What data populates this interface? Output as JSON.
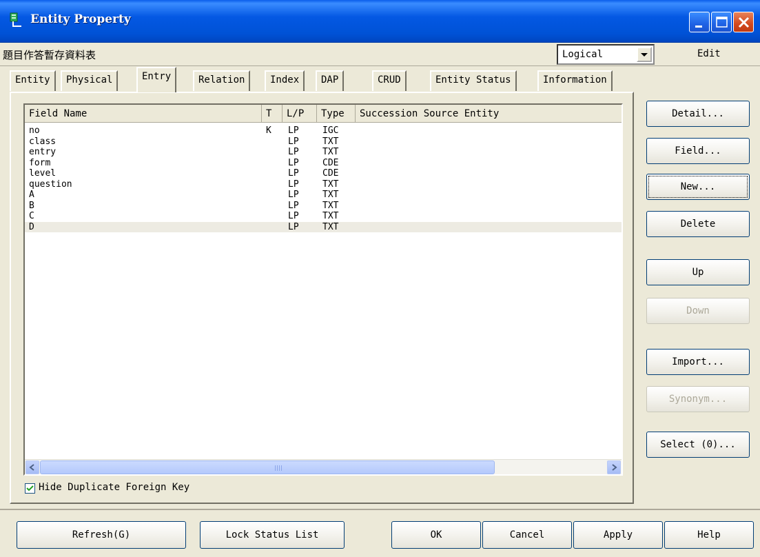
{
  "window": {
    "title": "Entity Property",
    "controls": {
      "minimize": "minimize",
      "maximize": "maximize",
      "close": "close"
    }
  },
  "entity_name": "題目作答暫存資料表",
  "view_select": {
    "value": "Logical"
  },
  "edit_label": "Edit",
  "tabs": [
    {
      "label": "Entity"
    },
    {
      "label": "Physical"
    },
    {
      "label": "Entry",
      "active": true
    },
    {
      "label": "Relation"
    },
    {
      "label": "Index"
    },
    {
      "label": "DAP"
    },
    {
      "label": "CRUD"
    },
    {
      "label": "Entity Status"
    },
    {
      "label": "Information"
    }
  ],
  "list": {
    "columns": [
      "Field  Name",
      "T",
      "L/P",
      "Type",
      "Succession Source Entity"
    ],
    "rows": [
      {
        "name": "no",
        "t": "K",
        "lp": "LP",
        "type": "IGC",
        "source": ""
      },
      {
        "name": "class",
        "t": "",
        "lp": "LP",
        "type": "TXT",
        "source": ""
      },
      {
        "name": "entry",
        "t": "",
        "lp": "LP",
        "type": "TXT",
        "source": ""
      },
      {
        "name": "form",
        "t": "",
        "lp": "LP",
        "type": "CDE",
        "source": ""
      },
      {
        "name": "level",
        "t": "",
        "lp": "LP",
        "type": "CDE",
        "source": ""
      },
      {
        "name": "question",
        "t": "",
        "lp": "LP",
        "type": "TXT",
        "source": ""
      },
      {
        "name": "A",
        "t": "",
        "lp": "LP",
        "type": "TXT",
        "source": ""
      },
      {
        "name": "B",
        "t": "",
        "lp": "LP",
        "type": "TXT",
        "source": ""
      },
      {
        "name": "C",
        "t": "",
        "lp": "LP",
        "type": "TXT",
        "source": ""
      },
      {
        "name": "D",
        "t": "",
        "lp": "LP",
        "type": "TXT",
        "source": "",
        "selected": true
      }
    ]
  },
  "hide_duplicate_fk": {
    "label": "Hide Duplicate Foreign Key",
    "checked": true
  },
  "side_buttons": {
    "detail": "Detail...",
    "field": "Field...",
    "new": "New...",
    "delete": "Delete",
    "up": "Up",
    "down": "Down",
    "import": "Import...",
    "synonym": "Synonym...",
    "select": "Select (0)..."
  },
  "bottom_buttons": {
    "refresh": "Refresh(G)",
    "lock_status": "Lock Status List",
    "ok": "OK",
    "cancel": "Cancel",
    "apply": "Apply",
    "help": "Help"
  },
  "colors": {
    "titlebar": "#0054E3",
    "dialog_bg": "#ECE9D8",
    "selected_row": "#EDEBE2",
    "disabled_text": "#ACA899"
  }
}
